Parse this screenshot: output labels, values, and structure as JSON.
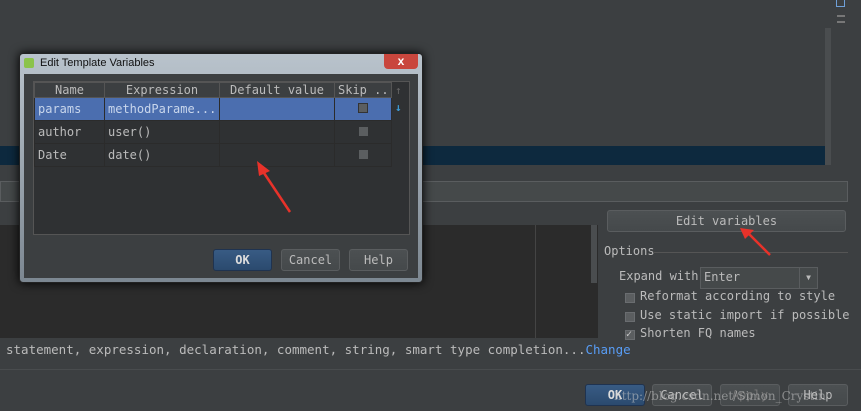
{
  "editor": {
    "description": "statement, expression, declaration, comment, string, smart type completion...",
    "change_link": "Change"
  },
  "right_panel": {
    "edit_variables": "Edit variables",
    "options_label": "Options",
    "expand_with_label": "Expand with",
    "expand_with_value": "Enter",
    "checkboxes": [
      {
        "label": "Reformat according to style",
        "checked": false
      },
      {
        "label": "Use static import if possible",
        "checked": false
      },
      {
        "label": "Shorten FQ names",
        "checked": true
      }
    ]
  },
  "footer": {
    "ok": "OK",
    "cancel": "Cancel",
    "apply": "Apply",
    "help": "Help",
    "watermark": "http://blog.csdn.net/Simon_Crystin"
  },
  "dialog": {
    "title": "Edit Template Variables",
    "close": "x",
    "columns": [
      "Name",
      "Expression",
      "Default value",
      "Skip ..."
    ],
    "rows": [
      {
        "name": "params",
        "expression": "methodParame...",
        "default": "",
        "skip": false,
        "selected": true
      },
      {
        "name": "author",
        "expression": "user()",
        "default": "",
        "skip": false,
        "selected": false
      },
      {
        "name": "Date",
        "expression": "date()",
        "default": "",
        "skip": false,
        "selected": false
      }
    ],
    "ok": "OK",
    "cancel": "Cancel",
    "help": "Help"
  },
  "colors": {
    "background": "#3c3f41",
    "selection": "#4b6eaf",
    "editor_selection": "#0d293e",
    "arrow": "#e8322a",
    "link": "#589df6"
  }
}
